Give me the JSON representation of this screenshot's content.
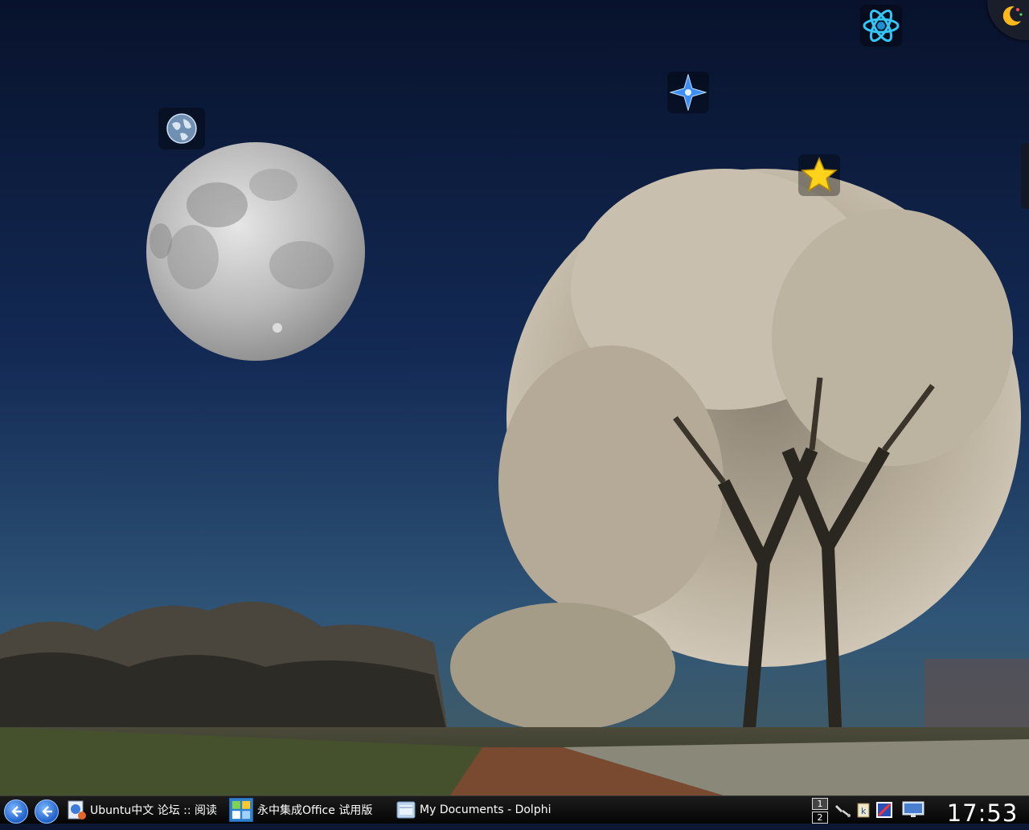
{
  "desktop": {
    "wallpaper_icons": [
      "globe-icon",
      "sparkle-star-icon",
      "atom-icon",
      "star-icon",
      "moon-cashew-icon"
    ]
  },
  "taskbar": {
    "tasks": [
      {
        "label": "Ubuntu中文 论坛 :: 阅读",
        "icon": "browser-icon"
      },
      {
        "label": "永中集成Office 试用版",
        "icon": "office-icon"
      },
      {
        "label": "My Documents - Dolphin",
        "icon": "folder-icon"
      }
    ],
    "pager": [
      "1",
      "2"
    ],
    "tray_icons": [
      "satellite-icon",
      "klipper-icon",
      "display-settings-icon",
      "monitor-icon"
    ],
    "clock": "17:53"
  },
  "colors": {
    "sky_top": "#0a1530",
    "sky_bottom": "#2f5577",
    "taskbar": "#0a0a0a",
    "accent": "#2a6fdc"
  }
}
